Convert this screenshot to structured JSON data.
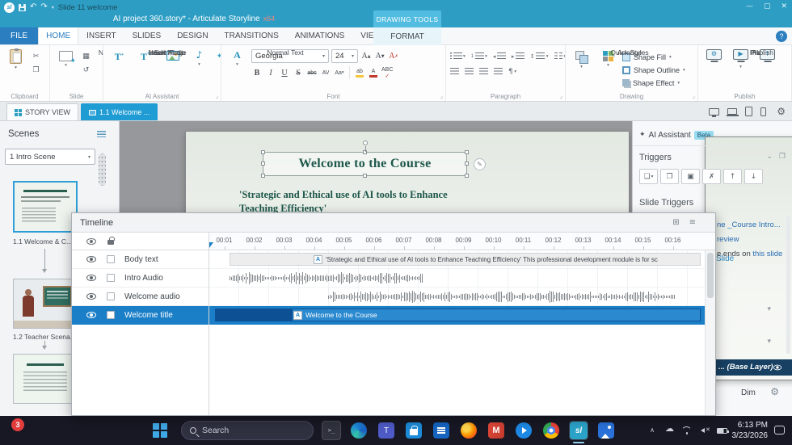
{
  "titlebar": {
    "logo": "sl",
    "quick_title": "Slide 11 welcome",
    "doc_title": "AI project 360.story* - Articulate Storyline",
    "doc_arch": "x64",
    "contextual_tab": "DRAWING TOOLS"
  },
  "ribbon": {
    "tabs": [
      "FILE",
      "HOME",
      "INSERT",
      "SLIDES",
      "DESIGN",
      "TRANSITIONS",
      "ANIMATIONS",
      "VIEW",
      "HELP"
    ],
    "format_tab": "FORMAT",
    "clipboard": {
      "label": "Clipboard",
      "paste": "Paste"
    },
    "slide_group": {
      "label": "Slide",
      "new_slide": "New Slide"
    },
    "ai": {
      "label": "AI Assistant",
      "insert_text": "Insert Text",
      "edit_text": "Edit Text",
      "insert_image": "Insert Image",
      "insert_audio": "Insert Audio"
    },
    "font": {
      "label": "Font",
      "style_button": "Normal Text",
      "family": "Georgia",
      "size": "24"
    },
    "paragraph": {
      "label": "Paragraph"
    },
    "drawing": {
      "label": "Drawing",
      "arrange": "Arrange",
      "quick_styles": "Quick Styles",
      "shape_fill": "Shape Fill",
      "shape_outline": "Shape Outline",
      "shape_effect": "Shape Effect"
    },
    "publish": {
      "label": "Publish",
      "player": "Player",
      "preview": "Preview",
      "publish": "Publish"
    }
  },
  "view_tabs": {
    "story_view": "STORY VIEW",
    "active_tab": "1.1 Welcome ..."
  },
  "scenes": {
    "header": "Scenes",
    "dropdown": "1 Intro Scene",
    "caption1": "1.1 Welcome & C...",
    "caption2": "1.2 Teacher Scena..."
  },
  "slide": {
    "title": "Welcome to the Course",
    "subtitle_line1": "'Strategic and Ethical use of AI tools to Enhance",
    "subtitle_line2": "Teaching Efficiency'"
  },
  "timeline": {
    "title": "Timeline",
    "ticks": [
      "00:01",
      "00:02",
      "00:03",
      "00:04",
      "00:05",
      "00:06",
      "00:07",
      "00:08",
      "00:09",
      "00:10",
      "00:11",
      "00:12",
      "00:13",
      "00:14",
      "00:15",
      "00:16"
    ],
    "rows": [
      {
        "name": "Body text"
      },
      {
        "name": "Intro Audio"
      },
      {
        "name": "Welcome audio"
      },
      {
        "name": "Welcome title"
      }
    ],
    "body_bar_text": "'Strategic and Ethical use of AI tools to Enhance Teaching Efficiency'  This professional development module is for sc",
    "title_bar_text": "Welcome to the Course",
    "object_icon": "A"
  },
  "right_panel": {
    "tab_slide": "Slide",
    "tab_ai": "AI Assistant",
    "beta_badge": "Beta",
    "triggers_header": "Triggers",
    "slide_triggers_header": "Slide Triggers",
    "fragment_1": "ne _Course Intro...",
    "fragment_2": "review",
    "fragment_3": "e ends on ",
    "fragment_3_link": "this slide",
    "base_layer": "... (Base Layer)",
    "dim_label": "Dim"
  },
  "taskbar": {
    "search_placeholder": "Search",
    "badge_count": "3",
    "time": "6:13 PM",
    "date": "3/23/2026"
  },
  "colors": {
    "titlebar": "#2d9dc4",
    "accent_blue": "#209cd4",
    "selection_blue": "#1b7fc8",
    "base_layer_navy": "#174062",
    "beta_cyan": "#9adcf0"
  }
}
